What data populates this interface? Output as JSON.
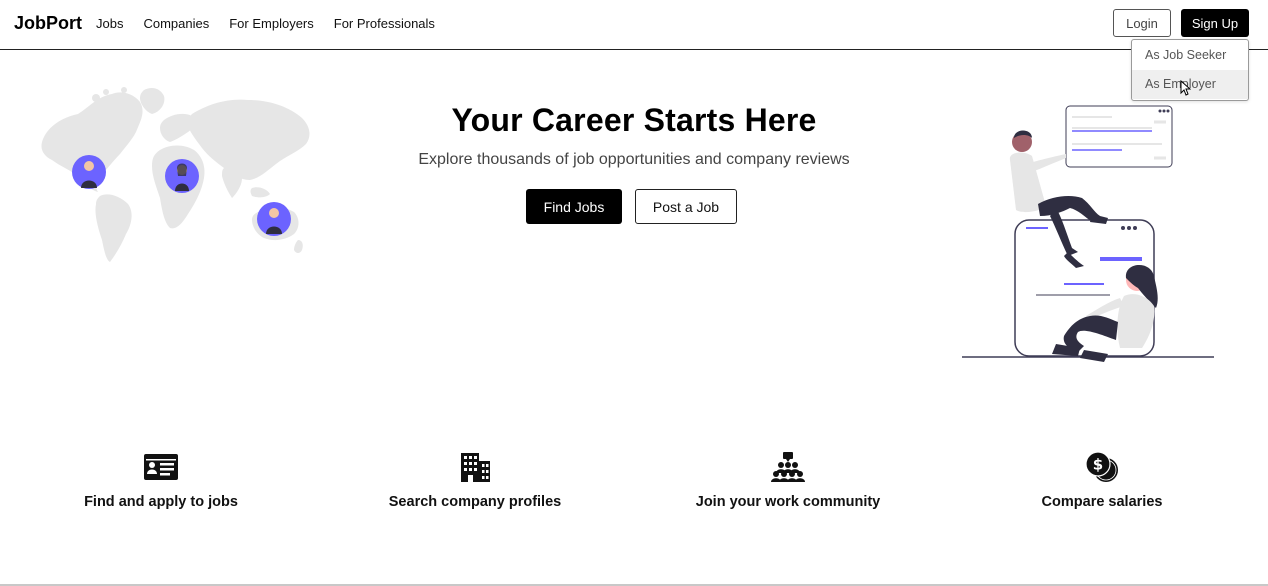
{
  "navbar": {
    "brand": "JobPort",
    "links": [
      "Jobs",
      "Companies",
      "For Employers",
      "For Professionals"
    ],
    "login_label": "Login",
    "signup_label": "Sign Up"
  },
  "signup_dropdown": {
    "items": [
      "As Job Seeker",
      "As Employer"
    ],
    "hovered_item": "As Employer"
  },
  "hero": {
    "title": "Your Career Starts Here",
    "subtitle": "Explore thousands of job opportunities and company reviews",
    "find_jobs_label": "Find Jobs",
    "post_job_label": "Post a Job"
  },
  "features": [
    {
      "icon": "id-card-icon",
      "label": "Find and apply to jobs"
    },
    {
      "icon": "building-icon",
      "label": "Search company profiles"
    },
    {
      "icon": "community-icon",
      "label": "Join your work community"
    },
    {
      "icon": "coins-dollar-icon",
      "label": "Compare salaries"
    }
  ],
  "colors": {
    "primary": "#000000",
    "accent": "#6c63ff",
    "map": "#e6e6e6",
    "muted_text": "#444444"
  }
}
